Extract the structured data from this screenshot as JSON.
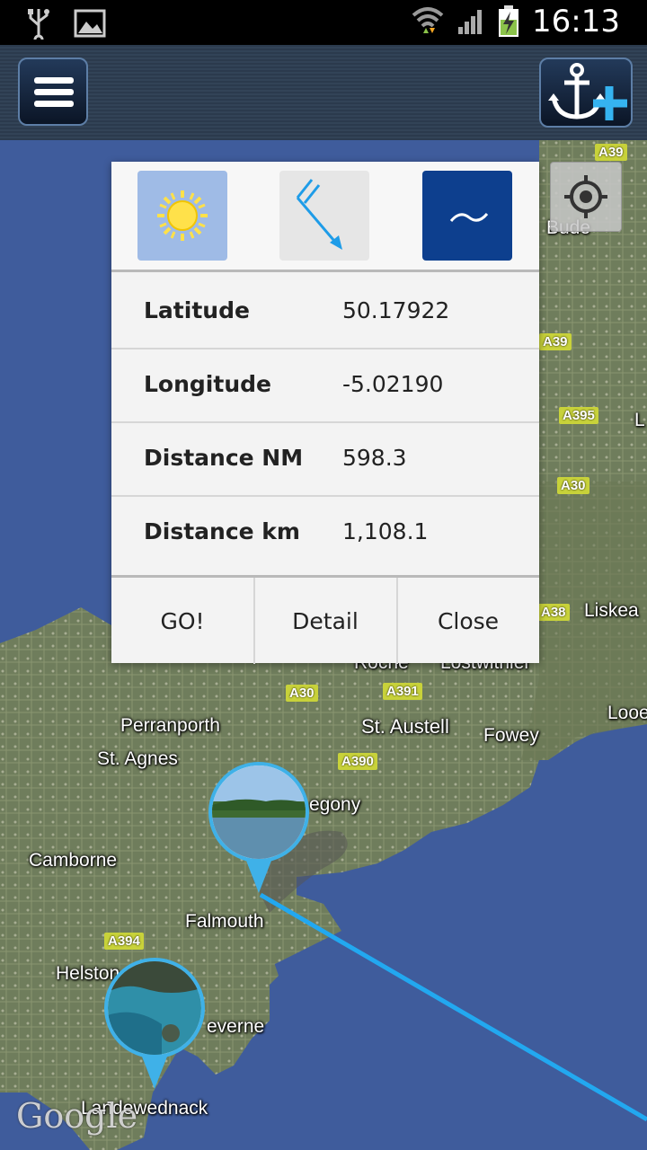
{
  "status_bar": {
    "time": "16:13",
    "icons": [
      "usb-icon",
      "image-icon",
      "wifi-icon",
      "signal-icon",
      "battery-charging-icon"
    ]
  },
  "action_bar": {
    "menu_icon": "hamburger-menu-icon",
    "add_anchor_icon": "anchor-plus-icon"
  },
  "map": {
    "locate_icon": "crosshair-icon",
    "attribution": "Google",
    "places": [
      "Bude",
      "Liskea",
      "Roche",
      "Lostwithiel",
      "Perranporth",
      "St. Agnes",
      "St. Austell",
      "Fowey",
      "Looe",
      "Camborne",
      "egony",
      "Falmouth",
      "Helston",
      "everne",
      "Landewednack",
      "L"
    ],
    "roads": [
      "A39",
      "A39",
      "A395",
      "A30",
      "A38",
      "A30",
      "A391",
      "A390",
      "A394"
    ]
  },
  "popup": {
    "tab_icons": [
      "sun-weather-icon",
      "wind-arrow-icon",
      "tide-wave-icon"
    ],
    "rows": [
      {
        "label": "Latitude",
        "value": "50.17922"
      },
      {
        "label": "Longitude",
        "value": "-5.02190"
      },
      {
        "label": "Distance NM",
        "value": "598.3"
      },
      {
        "label": "Distance km",
        "value": "1,108.1"
      }
    ],
    "buttons": {
      "go": "GO!",
      "detail": "Detail",
      "close": "Close"
    }
  },
  "colors": {
    "route_line": "#22a8f0",
    "pin_border": "#3fb1e8",
    "tide_tile": "#0d3f8e",
    "weather_tile": "#9fbbe6"
  }
}
